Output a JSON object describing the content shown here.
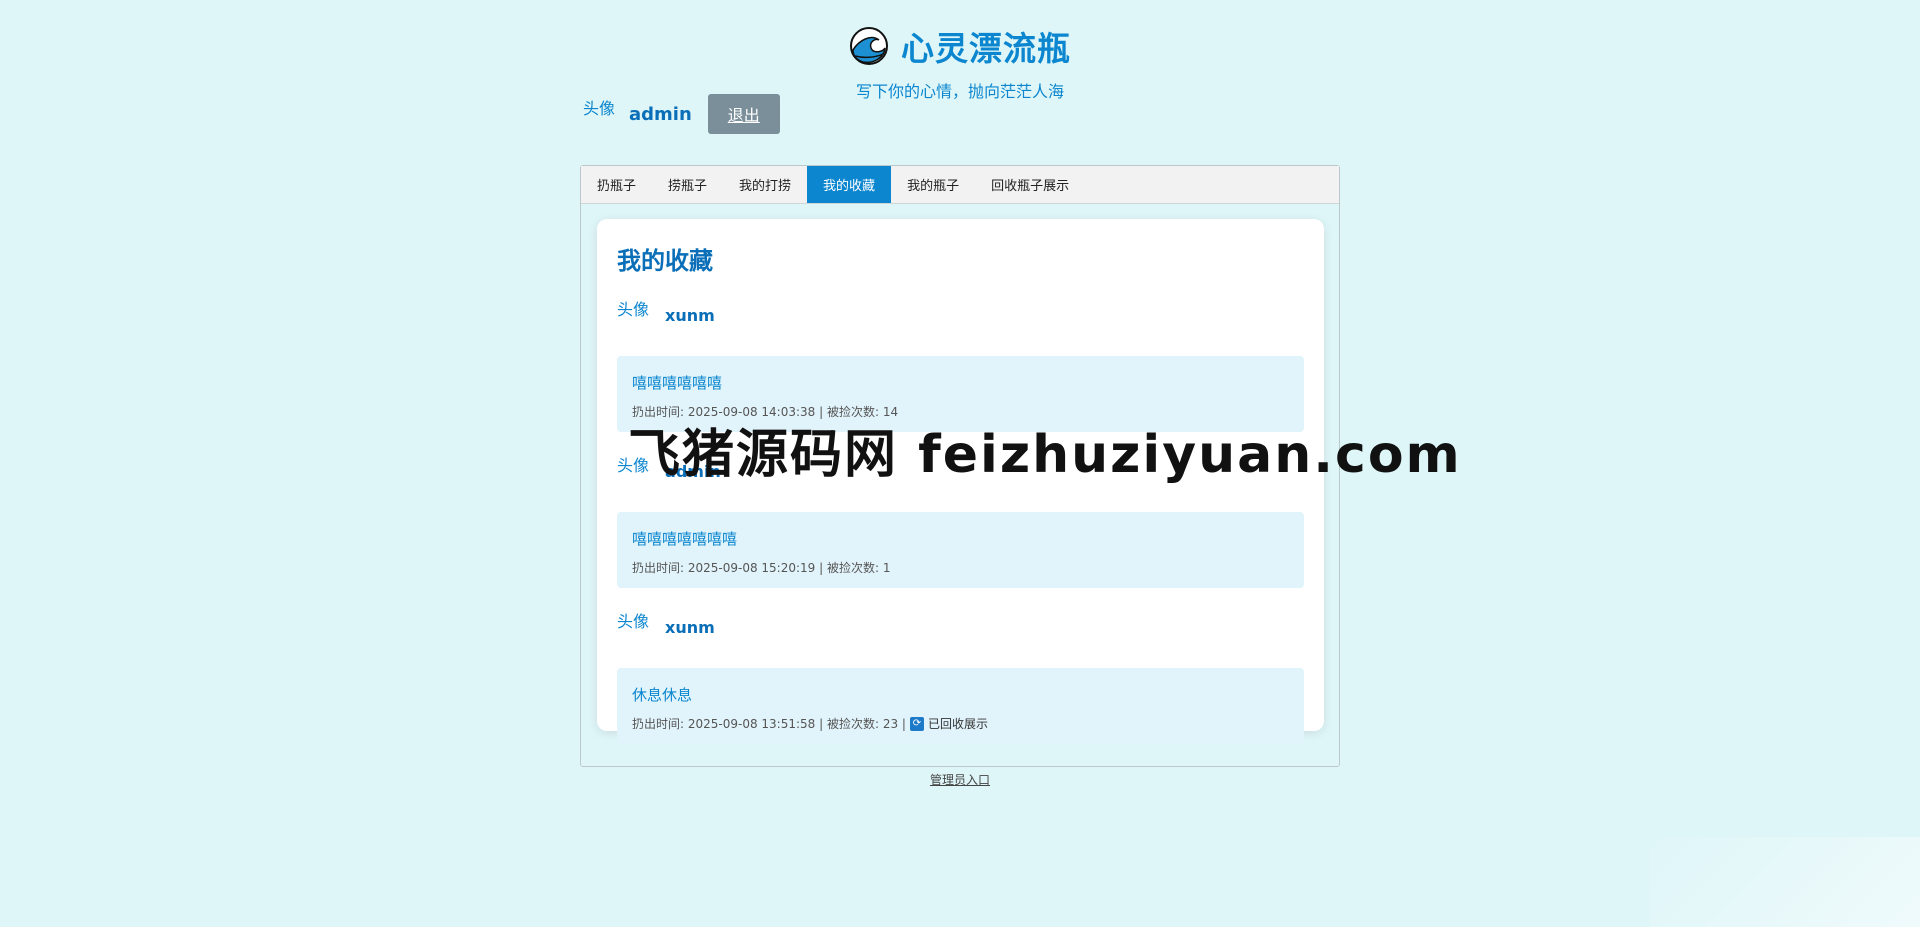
{
  "site": {
    "title": "心灵漂流瓶",
    "subtitle": "写下你的心情，抛向茫茫人海"
  },
  "user": {
    "avatar_alt": "头像",
    "name": "admin",
    "logout_label": "退出"
  },
  "tabs": [
    {
      "label": "扔瓶子"
    },
    {
      "label": "捞瓶子"
    },
    {
      "label": "我的打捞"
    },
    {
      "label": "我的收藏",
      "active": true
    },
    {
      "label": "我的瓶子"
    },
    {
      "label": "回收瓶子展示"
    }
  ],
  "favorites": {
    "title": "我的收藏",
    "items": [
      {
        "avatar_alt": "头像",
        "author": "xunm",
        "content": "嘻嘻嘻嘻嘻嘻",
        "meta": "扔出时间: 2025-09-08 14:03:38 | 被捡次数: 14"
      },
      {
        "avatar_alt": "头像",
        "author": "admin",
        "content": "嘻嘻嘻嘻嘻嘻嘻",
        "meta": "扔出时间: 2025-09-08 15:20:19 | 被捡次数: 1"
      },
      {
        "avatar_alt": "头像",
        "author": "xunm",
        "content": "休息休息",
        "meta": "扔出时间: 2025-09-08 13:51:58 | 被捡次数: 23 |",
        "recycled_label": "已回收展示"
      }
    ]
  },
  "footer": {
    "admin_link": "管理员入口"
  },
  "watermark": "飞猪源码网 feizhuziyuan.com",
  "colors": {
    "accent": "#0b86cf",
    "background": "#dff6f8"
  }
}
